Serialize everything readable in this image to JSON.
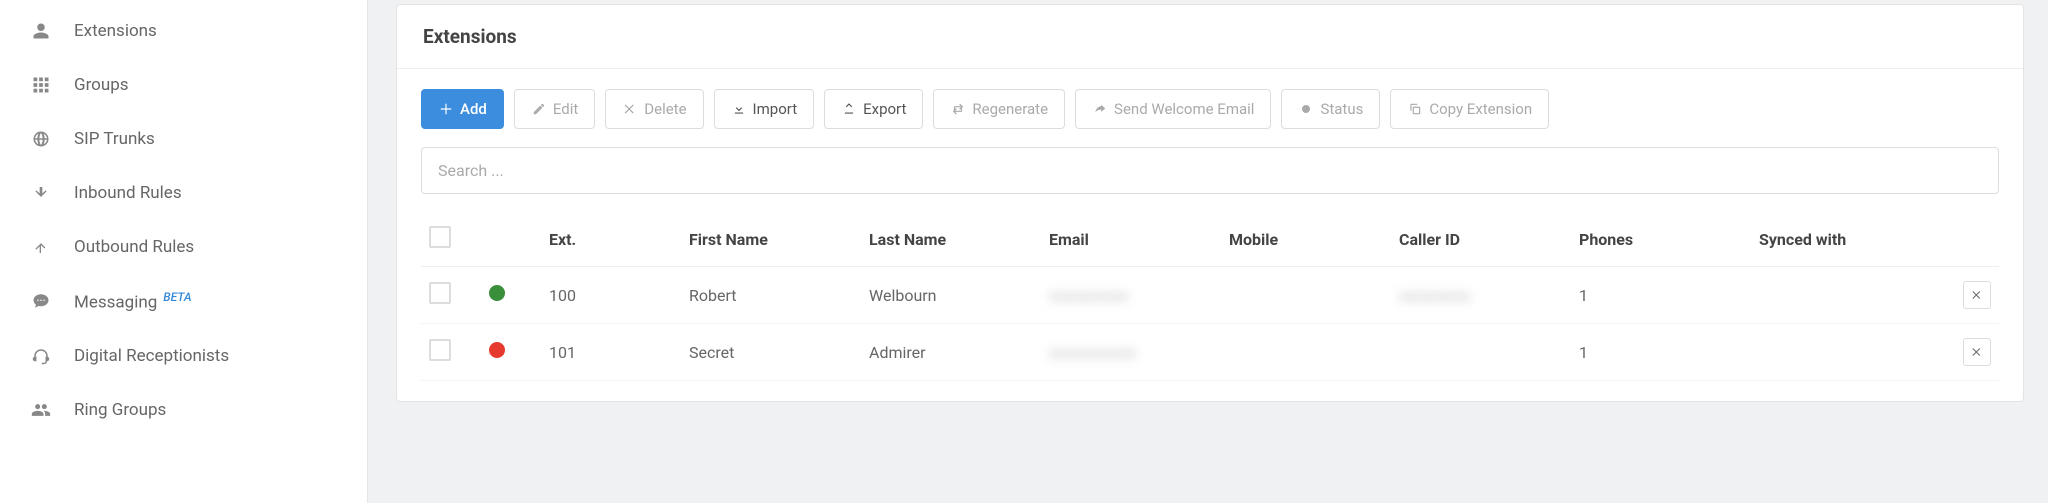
{
  "sidebar": {
    "items": [
      {
        "label": "Extensions",
        "icon": "user"
      },
      {
        "label": "Groups",
        "icon": "grid"
      },
      {
        "label": "SIP Trunks",
        "icon": "globe"
      },
      {
        "label": "Inbound Rules",
        "icon": "arrow-down"
      },
      {
        "label": "Outbound Rules",
        "icon": "arrow-up"
      },
      {
        "label": "Messaging",
        "icon": "chat",
        "badge": "BETA"
      },
      {
        "label": "Digital Receptionists",
        "icon": "headset"
      },
      {
        "label": "Ring Groups",
        "icon": "users"
      }
    ]
  },
  "panel": {
    "title": "Extensions"
  },
  "toolbar": {
    "add": "Add",
    "edit": "Edit",
    "delete": "Delete",
    "import": "Import",
    "export": "Export",
    "regenerate": "Regenerate",
    "send_welcome": "Send Welcome Email",
    "status": "Status",
    "copy_ext": "Copy Extension"
  },
  "search": {
    "placeholder": "Search ...",
    "value": ""
  },
  "table": {
    "headers": {
      "ext": "Ext.",
      "first_name": "First Name",
      "last_name": "Last Name",
      "email": "Email",
      "mobile": "Mobile",
      "caller_id": "Caller ID",
      "phones": "Phones",
      "synced_with": "Synced with"
    },
    "rows": [
      {
        "status": "green",
        "ext": "100",
        "first_name": "Robert",
        "last_name": "Welbourn",
        "email": "redacted",
        "mobile": "",
        "caller_id": "redacted",
        "phones": "1",
        "synced_with": ""
      },
      {
        "status": "red",
        "ext": "101",
        "first_name": "Secret",
        "last_name": "Admirer",
        "email": "redacted",
        "mobile": "",
        "caller_id": "",
        "phones": "1",
        "synced_with": ""
      }
    ]
  }
}
